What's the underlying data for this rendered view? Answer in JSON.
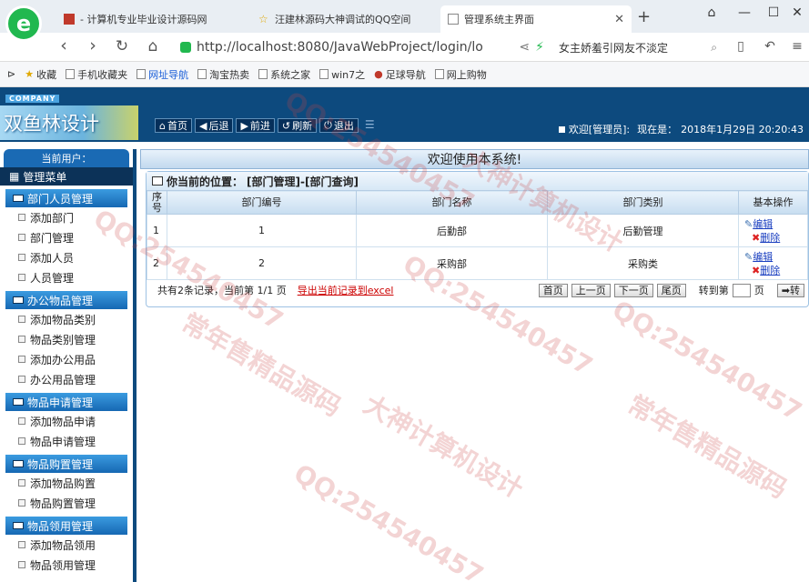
{
  "browser": {
    "logo_letter": "e",
    "tabs": [
      {
        "title": "- 计算机专业毕业设计源码网"
      },
      {
        "title": "汪建林源码大神调试的QQ空间"
      },
      {
        "title": "管理系统主界面"
      }
    ],
    "new_tab": "+",
    "url": "http://localhost:8080/JavaWebProject/login/lo",
    "search_text": "女主娇羞引网友不淡定",
    "bookmarks": [
      "收藏",
      "手机收藏夹",
      "网址导航",
      "淘宝热卖",
      "系统之家",
      "win7之",
      "足球导航",
      "网上购物"
    ]
  },
  "header": {
    "company": "COMPANY",
    "logo_text": "双鱼林设计",
    "toolbar": [
      "首页",
      "后退",
      "前进",
      "刷新",
      "退出"
    ],
    "welcome": "欢迎[管理员]:",
    "now_label": "现在是：",
    "datetime": "2018年1月29日  20:20:43"
  },
  "sidebar": {
    "current_user": "当前用户：",
    "menu_title": "管理菜单",
    "groups": [
      {
        "title": "部门人员管理",
        "items": [
          "添加部门",
          "部门管理",
          "添加人员",
          "人员管理"
        ]
      },
      {
        "title": "办公物品管理",
        "items": [
          "添加物品类别",
          "物品类别管理",
          "添加办公用品",
          "办公用品管理"
        ]
      },
      {
        "title": "物品申请管理",
        "items": [
          "添加物品申请",
          "物品申请管理"
        ]
      },
      {
        "title": "物品购置管理",
        "items": [
          "添加物品购置",
          "物品购置管理"
        ]
      },
      {
        "title": "物品领用管理",
        "items": [
          "添加物品领用",
          "物品领用管理"
        ]
      }
    ]
  },
  "main": {
    "welcome_bar": "欢迎使用本系统!",
    "location_label": "你当前的位置：",
    "location_path": "[部门管理]-[部门查询]",
    "table": {
      "headers": [
        "序号",
        "部门编号",
        "部门名称",
        "部门类别",
        "基本操作"
      ],
      "rows": [
        {
          "seq": "1",
          "code": "1",
          "name": "后勤部",
          "type": "后勤管理"
        },
        {
          "seq": "2",
          "code": "2",
          "name": "采购部",
          "type": "采购类"
        }
      ],
      "edit_label": "编辑",
      "delete_label": "删除"
    },
    "pager": {
      "summary": "共有2条记录，当前第 1/1 页",
      "export": "导出当前记录到excel",
      "buttons": [
        "首页",
        "上一页",
        "下一页",
        "尾页"
      ],
      "goto_label": "转到第",
      "page_unit": "页",
      "go_button": "转"
    }
  },
  "watermark": {
    "qq": "QQ:254540457",
    "slogan_1": "大神计算机设计",
    "slogan_2": "常年售精品源码"
  }
}
